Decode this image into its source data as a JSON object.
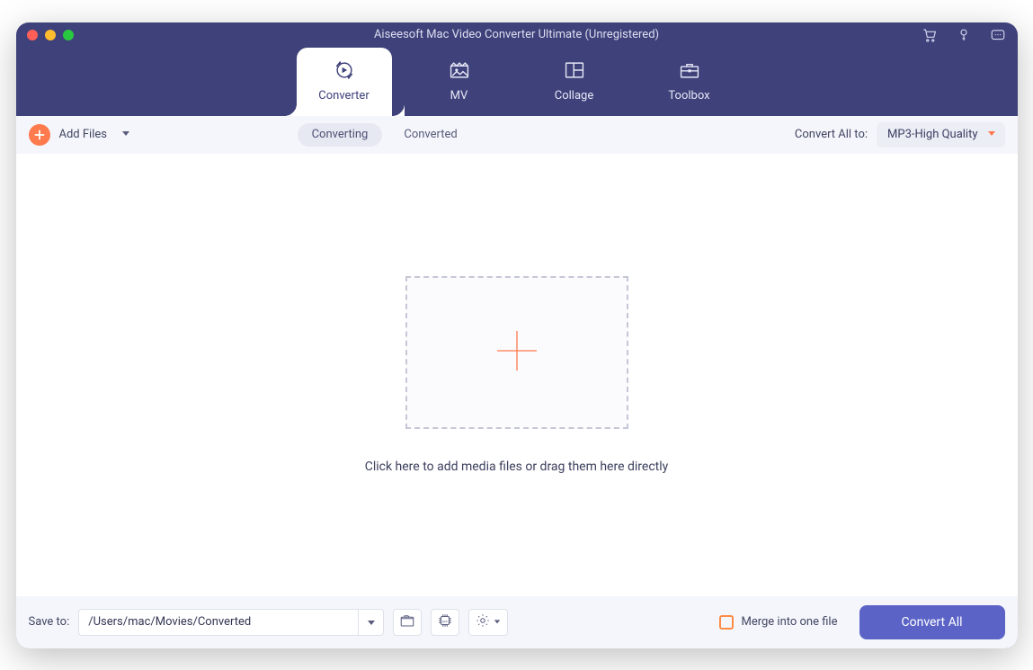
{
  "window": {
    "title": "Aiseesoft Mac Video Converter Ultimate (Unregistered)"
  },
  "titlebar_icons": {
    "cart": "cart-icon",
    "key": "key-icon",
    "feedback": "feedback-icon"
  },
  "nav": {
    "tabs": [
      {
        "label": "Converter",
        "active": true
      },
      {
        "label": "MV",
        "active": false
      },
      {
        "label": "Collage",
        "active": false
      },
      {
        "label": "Toolbox",
        "active": false
      }
    ]
  },
  "toolbar": {
    "add_files_label": "Add Files",
    "toggle": {
      "converting": "Converting",
      "converted": "Converted"
    },
    "convert_all_to_label": "Convert All to:",
    "format_selected": "MP3-High Quality"
  },
  "drop": {
    "hint": "Click here to add media files or drag them here directly"
  },
  "bottom": {
    "save_to_label": "Save to:",
    "save_path": "/Users/mac/Movies/Converted",
    "merge_label": "Merge into one file",
    "convert_all_button": "Convert All"
  }
}
